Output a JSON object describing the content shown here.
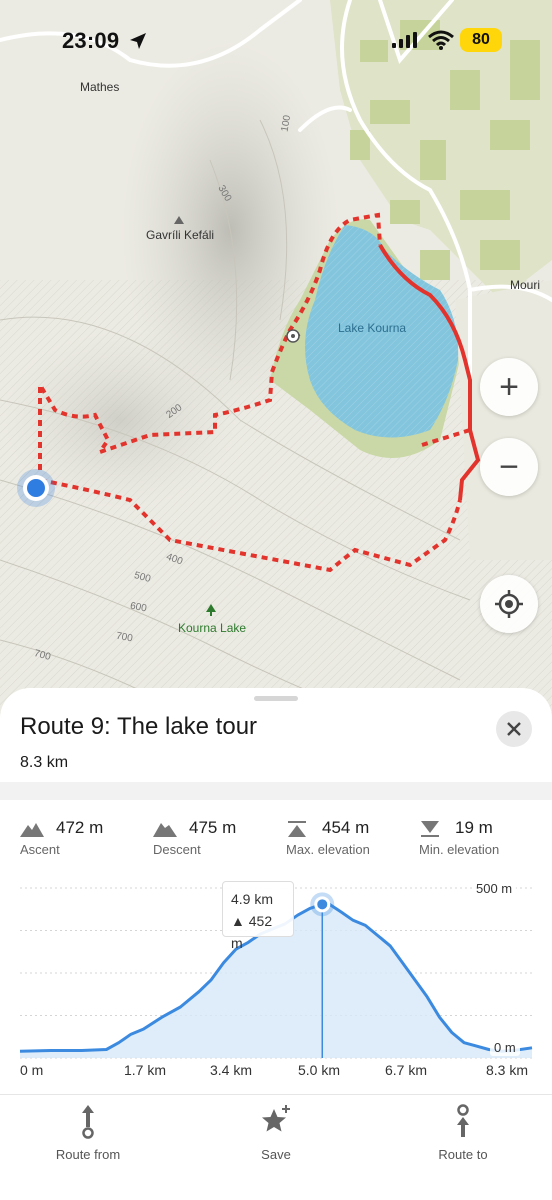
{
  "status_bar": {
    "time": "23:09",
    "battery": "80"
  },
  "map": {
    "labels": {
      "mathes": "Mathes",
      "gavrili": "Gavríli Kefáli",
      "lake": "Lake Kourna",
      "mouri": "Mouri",
      "kourna_lake": "Kourna Lake"
    },
    "contours": {
      "c100": "100",
      "c300": "300",
      "c200": "200",
      "c400": "400",
      "c500": "500",
      "c600": "600",
      "c700a": "700",
      "c700b": "700"
    },
    "buttons": {
      "zoom_in": "+",
      "zoom_out": "−"
    },
    "colors": {
      "route": "#e2332c",
      "lake": "#83c5dd",
      "position": "#2f7de1"
    }
  },
  "route": {
    "title": "Route 9: The lake tour",
    "distance": "8.3 km",
    "stats": [
      {
        "value": "472 m",
        "label": "Ascent",
        "icon": "ascent-icon"
      },
      {
        "value": "475 m",
        "label": "Descent",
        "icon": "descent-icon"
      },
      {
        "value": "454 m",
        "label": "Max. elevation",
        "icon": "max-elevation-icon"
      },
      {
        "value": "19 m",
        "label": "Min. elevation",
        "icon": "min-elevation-icon"
      }
    ]
  },
  "elevation_profile": {
    "y_top_label": "500 m",
    "y_bottom_label": "0 m",
    "x_labels": [
      "0 m",
      "1.7 km",
      "3.4 km",
      "5.0 km",
      "6.7 km",
      "8.3 km"
    ],
    "tooltip": {
      "distance": "4.9 km",
      "elevation": "▲ 452 m"
    },
    "marker_km": 4.9
  },
  "chart_data": {
    "type": "area",
    "xlabel": "",
    "ylabel": "",
    "x_ticks": [
      "0 m",
      "1.7 km",
      "3.4 km",
      "5.0 km",
      "6.7 km",
      "8.3 km"
    ],
    "x": [
      0,
      0.5,
      1.0,
      1.4,
      1.6,
      1.8,
      2.0,
      2.3,
      2.6,
      2.9,
      3.1,
      3.3,
      3.5,
      3.7,
      3.9,
      4.1,
      4.3,
      4.5,
      4.7,
      4.9,
      5.0,
      5.2,
      5.4,
      5.6,
      5.8,
      6.0,
      6.2,
      6.4,
      6.6,
      6.8,
      7.0,
      7.2,
      7.4,
      7.6,
      7.8,
      8.0,
      8.3
    ],
    "y": [
      20,
      22,
      22,
      25,
      45,
      70,
      85,
      120,
      150,
      195,
      230,
      280,
      320,
      340,
      365,
      380,
      395,
      420,
      440,
      452,
      454,
      430,
      405,
      390,
      360,
      330,
      280,
      230,
      180,
      120,
      75,
      45,
      35,
      25,
      20,
      22,
      30
    ],
    "xlim": [
      0,
      8.3
    ],
    "ylim": [
      0,
      500
    ]
  },
  "bottom_actions": [
    {
      "label": "Route from",
      "icon": "route-from-icon"
    },
    {
      "label": "Save",
      "icon": "save-star-icon"
    },
    {
      "label": "Route to",
      "icon": "route-to-icon"
    }
  ]
}
